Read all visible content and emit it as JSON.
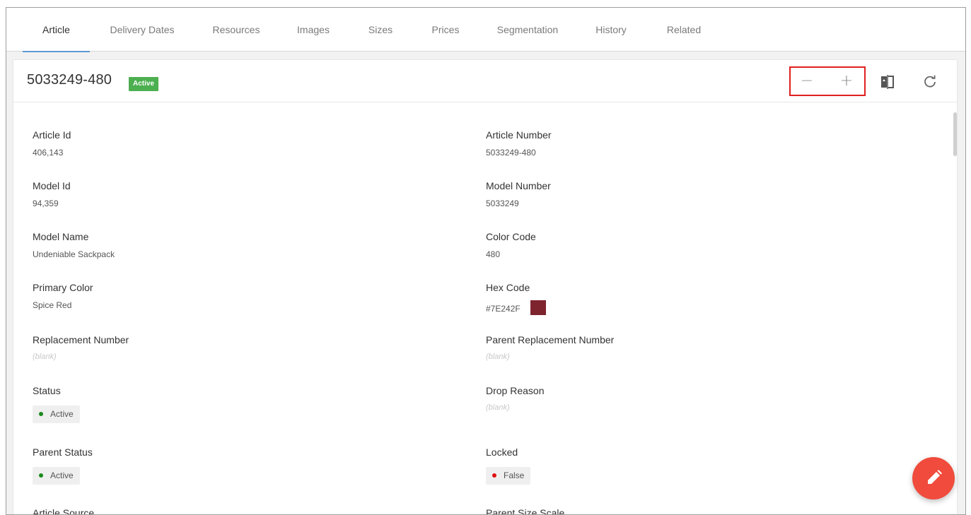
{
  "tabs": [
    {
      "label": "Article",
      "active": true
    },
    {
      "label": "Delivery Dates",
      "active": false
    },
    {
      "label": "Resources",
      "active": false
    },
    {
      "label": "Images",
      "active": false
    },
    {
      "label": "Sizes",
      "active": false
    },
    {
      "label": "Prices",
      "active": false
    },
    {
      "label": "Segmentation",
      "active": false
    },
    {
      "label": "History",
      "active": false
    },
    {
      "label": "Related",
      "active": false
    }
  ],
  "header": {
    "title": "5033249-480",
    "status_badge": "Active",
    "zoom_out": "−",
    "zoom_in": "+",
    "icons": {
      "compare": "compare-icon",
      "refresh": "refresh-icon"
    }
  },
  "fields": {
    "article_id": {
      "label": "Article Id",
      "value": "406,143"
    },
    "article_number": {
      "label": "Article Number",
      "value": "5033249-480"
    },
    "model_id": {
      "label": "Model Id",
      "value": "94,359"
    },
    "model_number": {
      "label": "Model Number",
      "value": "5033249"
    },
    "model_name": {
      "label": "Model Name",
      "value": "Undeniable Sackpack"
    },
    "color_code": {
      "label": "Color Code",
      "value": "480"
    },
    "primary_color": {
      "label": "Primary Color",
      "value": "Spice Red"
    },
    "hex_code": {
      "label": "Hex Code",
      "value": "#7E242F",
      "swatch_color": "#7E242F"
    },
    "replacement_number": {
      "label": "Replacement Number",
      "value": "(blank)"
    },
    "parent_replacement_number": {
      "label": "Parent Replacement Number",
      "value": "(blank)"
    },
    "status": {
      "label": "Status",
      "value": "Active",
      "dot_color": "#1b8a1b"
    },
    "drop_reason": {
      "label": "Drop Reason",
      "value": "(blank)"
    },
    "parent_status": {
      "label": "Parent Status",
      "value": "Active",
      "dot_color": "#1b8a1b"
    },
    "locked": {
      "label": "Locked",
      "value": "False",
      "dot_color": "#e01010"
    },
    "article_source": {
      "label": "Article Source"
    },
    "parent_size_scale": {
      "label": "Parent Size Scale"
    }
  },
  "colors": {
    "accent": "#5b9bd5",
    "badge": "#4caf50",
    "fab": "#f04b3c",
    "highlight": "#e02020"
  },
  "fab": {
    "icon": "pencil-icon"
  }
}
